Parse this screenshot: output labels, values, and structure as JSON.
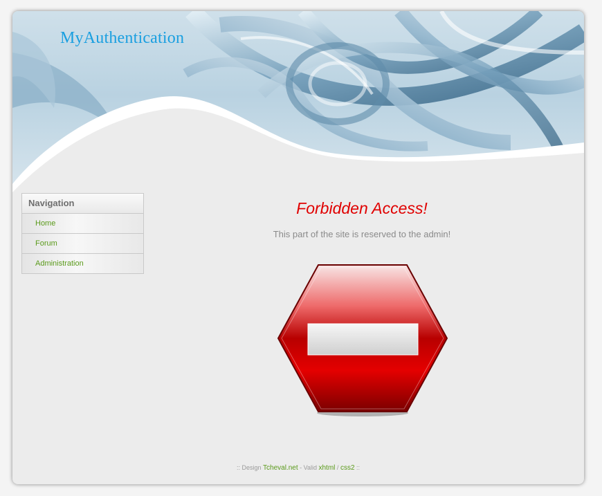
{
  "header": {
    "brand": "MyAuthentication"
  },
  "sidebar": {
    "title": "Navigation",
    "items": [
      {
        "label": "Home"
      },
      {
        "label": "Forum"
      },
      {
        "label": "Administration"
      }
    ]
  },
  "main": {
    "title": "Forbidden Access!",
    "message": "This part of the site is reserved to the admin!",
    "icon": "no-entry-icon"
  },
  "footer": {
    "prefix": ":: Design",
    "designer_link": "Tcheval.net",
    "valid_text": "- Valid",
    "xhtml_link": "xhtml",
    "separator": "/",
    "css_link": "css2",
    "suffix": "::"
  },
  "colors": {
    "accent": "#1a9fe0",
    "link": "#5a9a1a",
    "error": "#e00000"
  }
}
